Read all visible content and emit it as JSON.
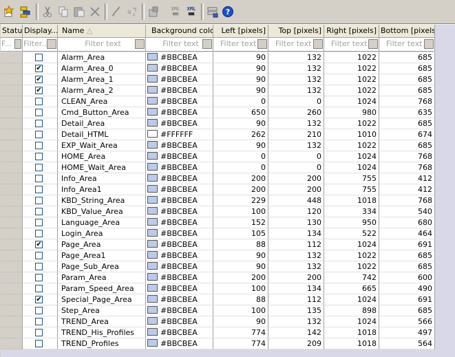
{
  "toolbar": {
    "buttons": [
      "new-item-icon",
      "sort-icon",
      "cut-icon",
      "copy-icon",
      "paste-icon",
      "delete-icon",
      "brush-icon",
      "find-replace-icon",
      "properties-icon",
      "xml-export-icon",
      "xml-import-icon",
      "settings-icon",
      "help-icon"
    ],
    "xml_label": "XML",
    "help_label": "?"
  },
  "columns": [
    "Status",
    "Display...",
    "Name",
    "Background color",
    "Left [pixels]",
    "Top [pixels]",
    "Right [pixels]",
    "Bottom [pixels]"
  ],
  "sort_indicator": "△",
  "filter": {
    "placeholder": "Filter text",
    "placeholder_short": "F...",
    "placeholder_mid": "Filter..."
  },
  "rows": [
    {
      "checked": false,
      "name": "Alarm_Area",
      "color": "#BBCBEA",
      "left": "90",
      "top": "132",
      "right": "1022",
      "bottom": "685"
    },
    {
      "checked": true,
      "name": "Alarm_Area_0",
      "color": "#BBCBEA",
      "left": "90",
      "top": "132",
      "right": "1022",
      "bottom": "685"
    },
    {
      "checked": true,
      "name": "Alarm_Area_1",
      "color": "#BBCBEA",
      "left": "90",
      "top": "132",
      "right": "1022",
      "bottom": "685"
    },
    {
      "checked": true,
      "name": "Alarm_Area_2",
      "color": "#BBCBEA",
      "left": "90",
      "top": "132",
      "right": "1022",
      "bottom": "685"
    },
    {
      "checked": false,
      "name": "CLEAN_Area",
      "color": "#BBCBEA",
      "left": "0",
      "top": "0",
      "right": "1024",
      "bottom": "768"
    },
    {
      "checked": false,
      "name": "Cmd_Button_Area",
      "color": "#BBCBEA",
      "left": "650",
      "top": "260",
      "right": "980",
      "bottom": "635"
    },
    {
      "checked": false,
      "name": "Detail_Area",
      "color": "#BBCBEA",
      "left": "90",
      "top": "132",
      "right": "1022",
      "bottom": "685"
    },
    {
      "checked": false,
      "name": "Detail_HTML",
      "color": "#FFFFFF",
      "left": "262",
      "top": "210",
      "right": "1010",
      "bottom": "674"
    },
    {
      "checked": false,
      "name": "EXP_Wait_Area",
      "color": "#BBCBEA",
      "left": "90",
      "top": "132",
      "right": "1022",
      "bottom": "685"
    },
    {
      "checked": false,
      "name": "HOME_Area",
      "color": "#BBCBEA",
      "left": "0",
      "top": "0",
      "right": "1024",
      "bottom": "768"
    },
    {
      "checked": false,
      "name": "HOME_Wait_Area",
      "color": "#BBCBEA",
      "left": "0",
      "top": "0",
      "right": "1024",
      "bottom": "768"
    },
    {
      "checked": false,
      "name": "Info_Area",
      "color": "#BBCBEA",
      "left": "200",
      "top": "200",
      "right": "755",
      "bottom": "412"
    },
    {
      "checked": false,
      "name": "Info_Area1",
      "color": "#BBCBEA",
      "left": "200",
      "top": "200",
      "right": "755",
      "bottom": "412"
    },
    {
      "checked": false,
      "name": "KBD_String_Area",
      "color": "#BBCBEA",
      "left": "229",
      "top": "448",
      "right": "1018",
      "bottom": "768"
    },
    {
      "checked": false,
      "name": "KBD_Value_Area",
      "color": "#BBCBEA",
      "left": "100",
      "top": "120",
      "right": "334",
      "bottom": "540"
    },
    {
      "checked": false,
      "name": "Language_Area",
      "color": "#BBCBEA",
      "left": "152",
      "top": "130",
      "right": "950",
      "bottom": "680"
    },
    {
      "checked": false,
      "name": "Login_Area",
      "color": "#BBCBEA",
      "left": "105",
      "top": "134",
      "right": "522",
      "bottom": "464"
    },
    {
      "checked": true,
      "name": "Page_Area",
      "color": "#BBCBEA",
      "left": "88",
      "top": "112",
      "right": "1024",
      "bottom": "691"
    },
    {
      "checked": false,
      "name": "Page_Area1",
      "color": "#BBCBEA",
      "left": "90",
      "top": "132",
      "right": "1022",
      "bottom": "685"
    },
    {
      "checked": false,
      "name": "Page_Sub_Area",
      "color": "#BBCBEA",
      "left": "90",
      "top": "132",
      "right": "1022",
      "bottom": "685"
    },
    {
      "checked": false,
      "name": "Param_Area",
      "color": "#BBCBEA",
      "left": "200",
      "top": "200",
      "right": "742",
      "bottom": "600"
    },
    {
      "checked": false,
      "name": "Param_Speed_Area",
      "color": "#BBCBEA",
      "left": "100",
      "top": "134",
      "right": "665",
      "bottom": "490"
    },
    {
      "checked": true,
      "name": "Special_Page_Area",
      "color": "#BBCBEA",
      "left": "88",
      "top": "112",
      "right": "1024",
      "bottom": "691"
    },
    {
      "checked": false,
      "name": "Step_Area",
      "color": "#BBCBEA",
      "left": "100",
      "top": "135",
      "right": "898",
      "bottom": "685"
    },
    {
      "checked": false,
      "name": "TREND_Area",
      "color": "#BBCBEA",
      "left": "90",
      "top": "132",
      "right": "1024",
      "bottom": "566"
    },
    {
      "checked": false,
      "name": "TREND_His_Profiles",
      "color": "#BBCBEA",
      "left": "774",
      "top": "142",
      "right": "1018",
      "bottom": "497"
    },
    {
      "checked": false,
      "name": "TREND_Profiles",
      "color": "#BBCBEA",
      "left": "774",
      "top": "209",
      "right": "1018",
      "bottom": "564"
    }
  ]
}
